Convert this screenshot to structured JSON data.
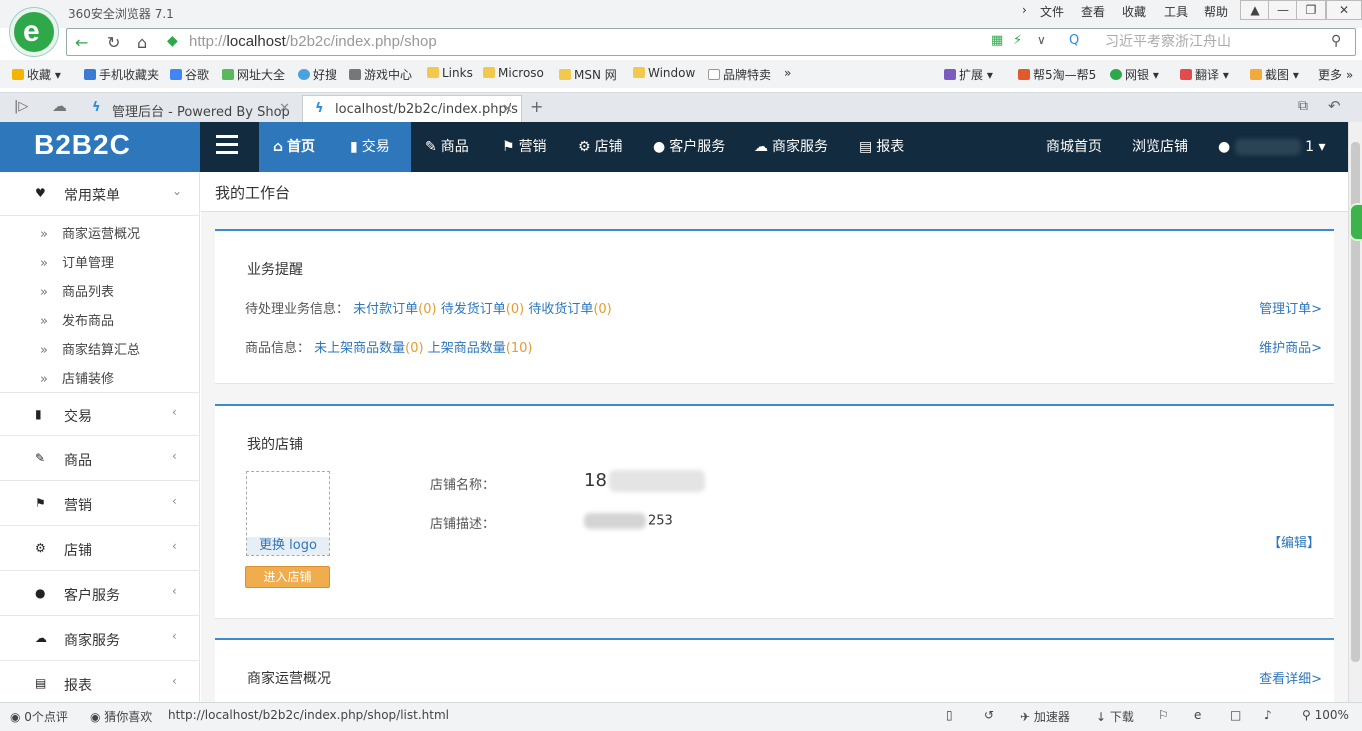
{
  "browser": {
    "app_title": "360安全浏览器 7.1",
    "menu": [
      "文件",
      "查看",
      "收藏",
      "工具",
      "帮助"
    ],
    "url_prefix": "http://",
    "url_host": "localhost",
    "url_path": "/b2b2c/index.php/shop",
    "search_placeholder": "习近平考察浙江舟山",
    "bookmarks": [
      "收藏",
      "手机收藏夹",
      "谷歌",
      "网址大全",
      "好搜",
      "游戏中心",
      "Links",
      "Microso",
      "MSN 网",
      "Window",
      "品牌特卖",
      "扩展",
      "帮5淘—帮5",
      "网银",
      "翻译",
      "截图",
      "更多"
    ],
    "tabs": [
      {
        "label": "管理后台 - Powered By Shop",
        "active": false
      },
      {
        "label": "localhost/b2b2c/index.php/s",
        "active": true
      }
    ],
    "status": {
      "comments": "0个点评",
      "guess": "猜你喜欢",
      "hover_url": "http://localhost/b2b2c/index.php/shop/list.html",
      "accelerator": "加速器",
      "download": "下载",
      "zoom": "100%"
    }
  },
  "app": {
    "brand": "B2B2C",
    "nav": [
      {
        "icon": "home-icon",
        "glyph": "⌂",
        "label": "首页",
        "active": true
      },
      {
        "icon": "chart-icon",
        "glyph": "▮",
        "label": "交易",
        "active": false
      },
      {
        "icon": "edit-icon",
        "glyph": "✎",
        "label": "商品",
        "active": false
      },
      {
        "icon": "bookmark-icon",
        "glyph": "⚑",
        "label": "营销",
        "active": false
      },
      {
        "icon": "gear-icon",
        "glyph": "⚙",
        "label": "店铺",
        "active": false
      },
      {
        "icon": "chat-icon",
        "glyph": "●",
        "label": "客户服务",
        "active": false
      },
      {
        "icon": "cloud-icon",
        "glyph": "☁",
        "label": "商家服务",
        "active": false
      },
      {
        "icon": "list-icon",
        "glyph": "▤",
        "label": "报表",
        "active": false
      }
    ],
    "right_nav": [
      "商城首页",
      "浏览店铺"
    ],
    "user_suffix": "1",
    "sidebar": {
      "common_menu": "常用菜单",
      "sub_items": [
        "商家运营概况",
        "订单管理",
        "商品列表",
        "发布商品",
        "商家结算汇总",
        "店铺装修"
      ],
      "groups": [
        {
          "icon": "chart-icon",
          "glyph": "▮",
          "label": "交易"
        },
        {
          "icon": "edit-icon",
          "glyph": "✎",
          "label": "商品"
        },
        {
          "icon": "bookmark-icon",
          "glyph": "⚑",
          "label": "营销"
        },
        {
          "icon": "gear-icon",
          "glyph": "⚙",
          "label": "店铺"
        },
        {
          "icon": "chat-icon",
          "glyph": "●",
          "label": "客户服务"
        },
        {
          "icon": "cloud-icon",
          "glyph": "☁",
          "label": "商家服务"
        },
        {
          "icon": "list-icon",
          "glyph": "▤",
          "label": "报表"
        }
      ]
    },
    "breadcrumb": "我的工作台",
    "reminders": {
      "title": "业务提醒",
      "pending_label": "待处理业务信息：",
      "unpaid": "未付款订单",
      "unpaid_count": "(0)",
      "to_ship": "待发货订单",
      "to_ship_count": "(0)",
      "to_receive": "待收货订单",
      "to_receive_count": "(0)",
      "manage_orders": "管理订单>",
      "goods_label": "商品信息：",
      "offline": "未上架商品数量",
      "offline_count": "(0)",
      "online": "上架商品数量",
      "online_count": "(10)",
      "maintain_goods": "维护商品>"
    },
    "shop": {
      "title": "我的店铺",
      "change_logo": "更换 logo",
      "enter_shop": "进入店铺",
      "name_label": "店铺名称：",
      "name_value": "18",
      "desc_label": "店铺描述：",
      "desc_value": "253",
      "edit": "【编辑】"
    },
    "overview": {
      "title": "商家运营概况",
      "details": "查看详细>"
    }
  }
}
